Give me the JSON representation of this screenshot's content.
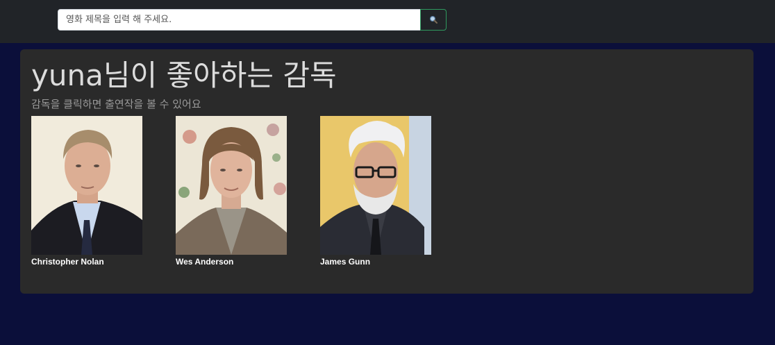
{
  "search": {
    "placeholder": "영화 제목을 입력 해 주세요.",
    "button_icon": "search-icon"
  },
  "main": {
    "title": "yuna님이 좋아하는 감독",
    "subtitle": "감독을 클릭하면 출연작을 볼 수 있어요"
  },
  "directors": [
    {
      "name": "Christopher Nolan",
      "photo": "portrait-photo"
    },
    {
      "name": "Wes Anderson",
      "photo": "portrait-photo"
    },
    {
      "name": "James Gunn",
      "photo": "portrait-photo"
    }
  ],
  "colors": {
    "page_background": "#0b0f3a",
    "topbar": "#212428",
    "card": "#2a2a2a",
    "search_button_border": "#2f9a5f"
  }
}
